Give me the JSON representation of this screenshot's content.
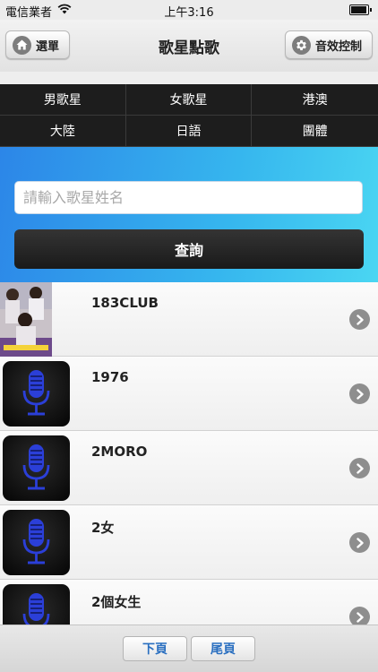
{
  "status_bar": {
    "carrier": "電信業者",
    "time": "上午3:16"
  },
  "nav": {
    "title": "歌星點歌",
    "menu_label": "選單",
    "sound_label": "音效控制"
  },
  "categories": [
    "男歌星",
    "女歌星",
    "港澳",
    "大陸",
    "日語",
    "團體"
  ],
  "search": {
    "placeholder": "請輸入歌星姓名",
    "button_label": "查詢",
    "value": ""
  },
  "singers": [
    {
      "name": "183CLUB",
      "thumb": "photo"
    },
    {
      "name": "1976",
      "thumb": "microphone-icon"
    },
    {
      "name": "2MORO",
      "thumb": "microphone-icon"
    },
    {
      "name": "2女",
      "thumb": "microphone-icon"
    },
    {
      "name": "2個女生",
      "thumb": "microphone-icon"
    }
  ],
  "pager": {
    "next_label": "下頁",
    "last_label": "尾頁"
  },
  "colors": {
    "search_gradient_start": "#2c86e8",
    "search_gradient_end": "#4ad6f2",
    "category_bar": "#1d1d1d",
    "page_button_text": "#2a6fc0",
    "microphone_blue": "#2b3fd8"
  }
}
